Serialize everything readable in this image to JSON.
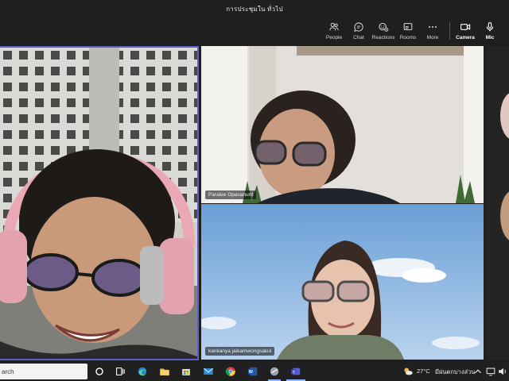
{
  "window": {
    "title": "การประชุมใน ทั่วไป"
  },
  "toolbar": {
    "people": "People",
    "chat": "Chat",
    "reactions": "Reactions",
    "rooms": "Rooms",
    "more": "More",
    "camera": "Camera",
    "mic": "Mic"
  },
  "participants": [
    {
      "name": ""
    },
    {
      "name": "Paralee Opasanunt"
    },
    {
      "name": "kankanya jaikamwongsakul"
    }
  ],
  "taskbar": {
    "search_text": "arch",
    "weather_temp": "27°C",
    "weather_text": "มีฝนตกบางส่วน"
  },
  "colors": {
    "active_speaker_border": "#5b5fc7",
    "background": "#1f1f1f"
  }
}
